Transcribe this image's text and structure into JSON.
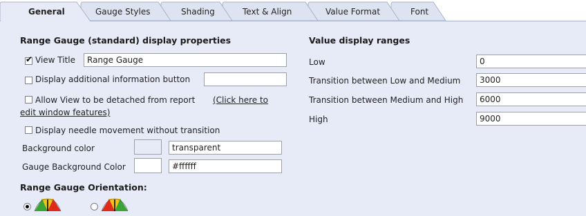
{
  "tabs": [
    {
      "label": "General",
      "active": true
    },
    {
      "label": "Gauge Styles",
      "active": false
    },
    {
      "label": "Shading",
      "active": false
    },
    {
      "label": "Text & Align",
      "active": false
    },
    {
      "label": "Value Format",
      "active": false
    },
    {
      "label": "Font",
      "active": false
    }
  ],
  "left": {
    "title": "Range Gauge (standard) display properties",
    "view_title": {
      "label": "View Title",
      "checked": true,
      "value": "Range Gauge"
    },
    "info_button": {
      "label": "Display additional information button",
      "checked": false,
      "value": ""
    },
    "detach": {
      "label": "Allow View to be detached from report",
      "link_part1": "(Click here to",
      "link_part2": "edit window features)",
      "checked": false
    },
    "needle": {
      "label": "Display needle movement without transition",
      "checked": false
    },
    "background_color": {
      "label": "Background color",
      "value": "transparent",
      "swatch": "#e6ebf7"
    },
    "gauge_background_color": {
      "label": "Gauge Background Color",
      "value": "#ffffff",
      "swatch": "#ffffff"
    },
    "orientation_title": "Range Gauge Orientation:",
    "orientation_selected": "first"
  },
  "right": {
    "title": "Value display ranges",
    "ranges": [
      {
        "label": "Low",
        "value": "0"
      },
      {
        "label": "Transition between Low and Medium",
        "value": "3000"
      },
      {
        "label": "Transition between Medium and High",
        "value": "6000"
      },
      {
        "label": "High",
        "value": "9000"
      }
    ]
  },
  "colors": {
    "panel_bg": "#e6ebf7",
    "tab_bg": "#dde3f1",
    "tab_active_bg": "#e6ebf7",
    "gauge_green": "#3aa435",
    "gauge_red": "#e02a1a",
    "gauge_yellow": "#f2c418"
  }
}
